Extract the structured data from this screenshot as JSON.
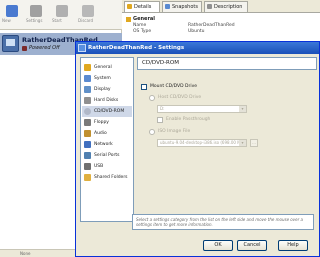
{
  "toolbar": {
    "buttons": [
      {
        "label": "New",
        "icon": "new-vm-icon",
        "color": "#4a7ad0"
      },
      {
        "label": "Settings",
        "icon": "settings-gear-icon",
        "color": "#a0a0a0"
      },
      {
        "label": "Start",
        "icon": "start-arrow-icon",
        "color": "#b0b0b0"
      },
      {
        "label": "Discard",
        "icon": "discard-icon",
        "color": "#b8b8b8"
      }
    ]
  },
  "vm_list": {
    "items": [
      {
        "name": "RatherDeadThanRed",
        "state": "Powered Off"
      }
    ]
  },
  "details": {
    "tabs": [
      "Details",
      "Snapshots",
      "Description"
    ],
    "general_header": "General",
    "fields": [
      {
        "key": "Name",
        "value": "RatherDeadThanRed"
      },
      {
        "key": "OS Type",
        "value": "Ubuntu"
      }
    ]
  },
  "dialog": {
    "title": "RatherDeadThanRed - Settings",
    "categories": [
      {
        "label": "General",
        "icon": "general-icon",
        "color": "#e0a820"
      },
      {
        "label": "System",
        "icon": "system-icon",
        "color": "#5a8ad0"
      },
      {
        "label": "Display",
        "icon": "display-icon",
        "color": "#6090c8"
      },
      {
        "label": "Hard Disks",
        "icon": "hard-disk-icon",
        "color": "#909090"
      },
      {
        "label": "CD/DVD-ROM",
        "icon": "cd-dvd-icon",
        "color": "#b0b8c8"
      },
      {
        "label": "Floppy",
        "icon": "floppy-icon",
        "color": "#7a7a7a"
      },
      {
        "label": "Audio",
        "icon": "audio-icon",
        "color": "#c09030"
      },
      {
        "label": "Network",
        "icon": "network-icon",
        "color": "#4070c0"
      },
      {
        "label": "Serial Ports",
        "icon": "serial-port-icon",
        "color": "#5080b0"
      },
      {
        "label": "USB",
        "icon": "usb-icon",
        "color": "#707070"
      },
      {
        "label": "Shared Folders",
        "icon": "shared-folder-icon",
        "color": "#e0b040"
      }
    ],
    "selected_category": "CD/DVD-ROM",
    "page_title": "CD/DVD-ROM",
    "mount_label": "Mount CD/DVD Drive",
    "host_drive_label": "Host CD/DVD Drive",
    "host_drive_value": "D:",
    "passthrough_label": "Enable Passthrough",
    "iso_label": "ISO Image File",
    "iso_value": "ubuntu-9.04-desktop-i386.iso (698.00 MB)",
    "hint": "Select a settings category from the list on the left side and move the mouse over a settings item to get more information.",
    "buttons": {
      "ok": "OK",
      "cancel": "Cancel",
      "help": "Help"
    }
  },
  "status": {
    "text": "None"
  }
}
